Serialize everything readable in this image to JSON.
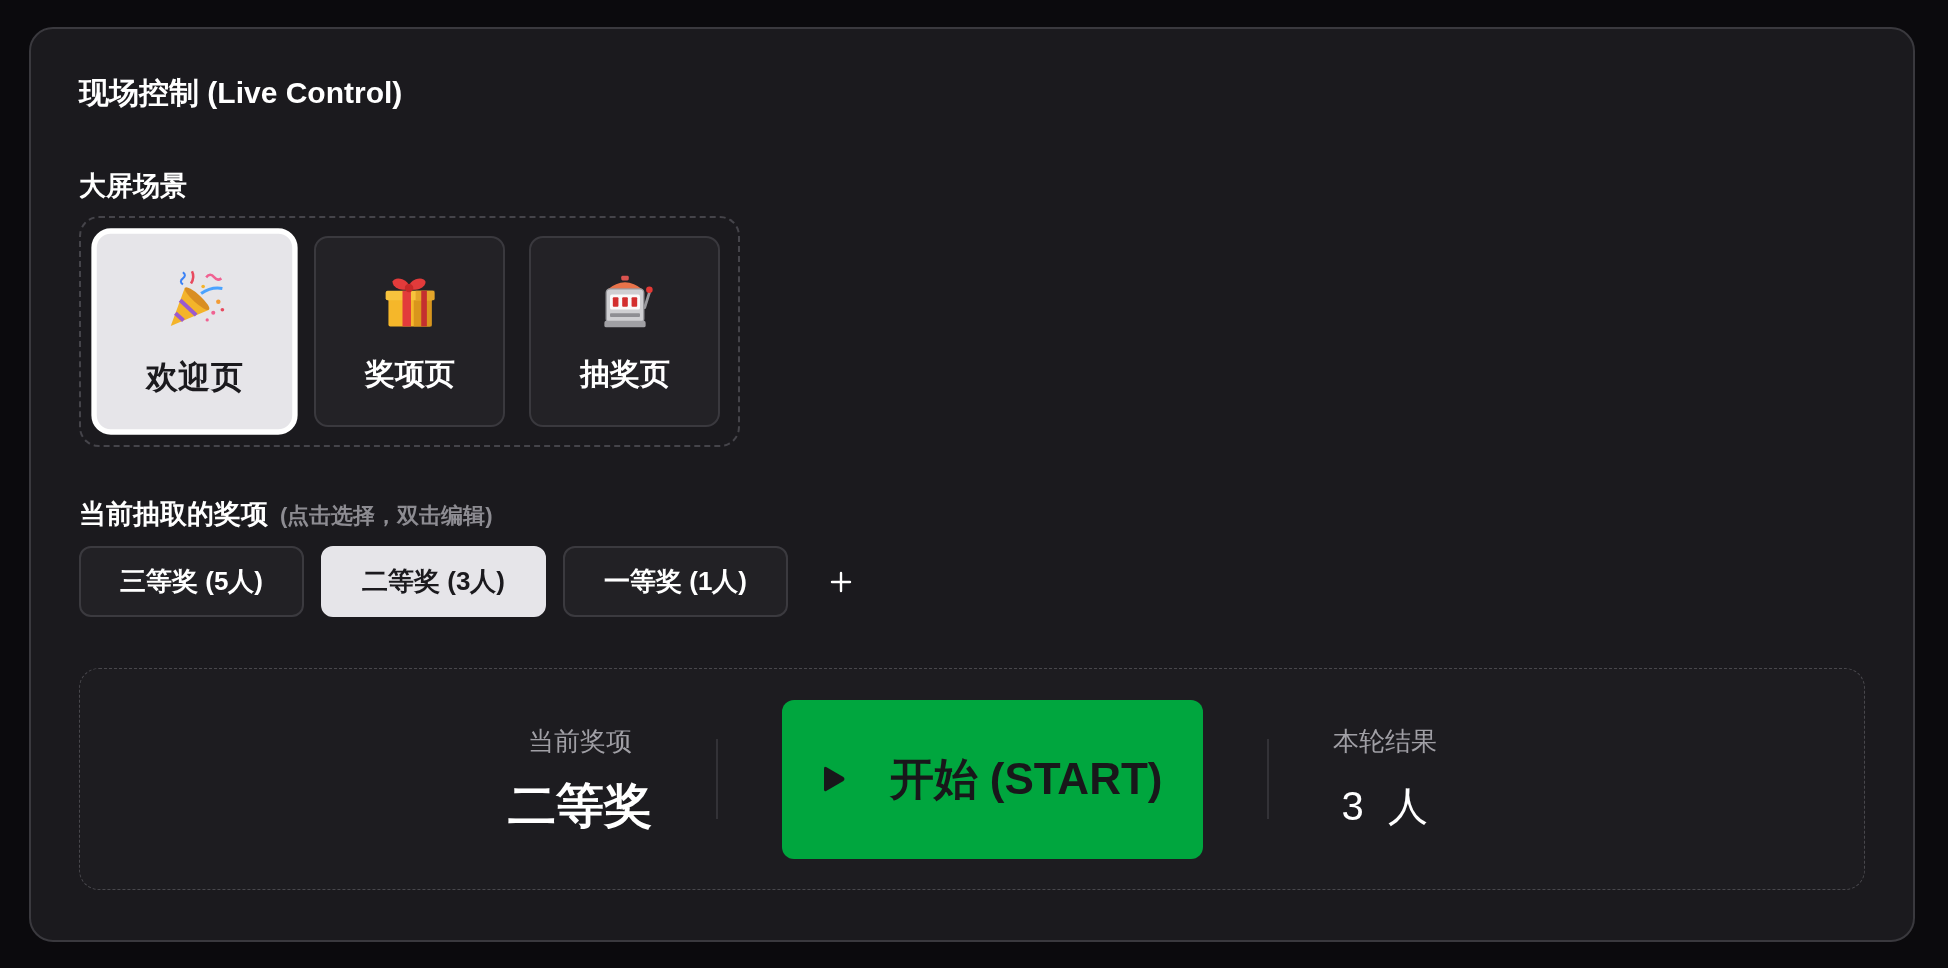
{
  "panel": {
    "title": "现场控制 (Live Control)"
  },
  "scenes": {
    "label": "大屏场景",
    "items": [
      {
        "label": "欢迎页",
        "selected": true
      },
      {
        "label": "奖项页",
        "selected": false
      },
      {
        "label": "抽奖页",
        "selected": false
      }
    ]
  },
  "prizes": {
    "label": "当前抽取的奖项",
    "hint": "(点击选择，双击编辑)",
    "items": [
      {
        "label": "三等奖 (5人)",
        "selected": false
      },
      {
        "label": "二等奖 (3人)",
        "selected": true
      },
      {
        "label": "一等奖 (1人)",
        "selected": false
      }
    ]
  },
  "draw": {
    "current_label": "当前奖项",
    "current_prize": "二等奖",
    "start_button": "开始 (START)",
    "result_label": "本轮结果",
    "result_count": "3",
    "result_unit": "人"
  }
}
